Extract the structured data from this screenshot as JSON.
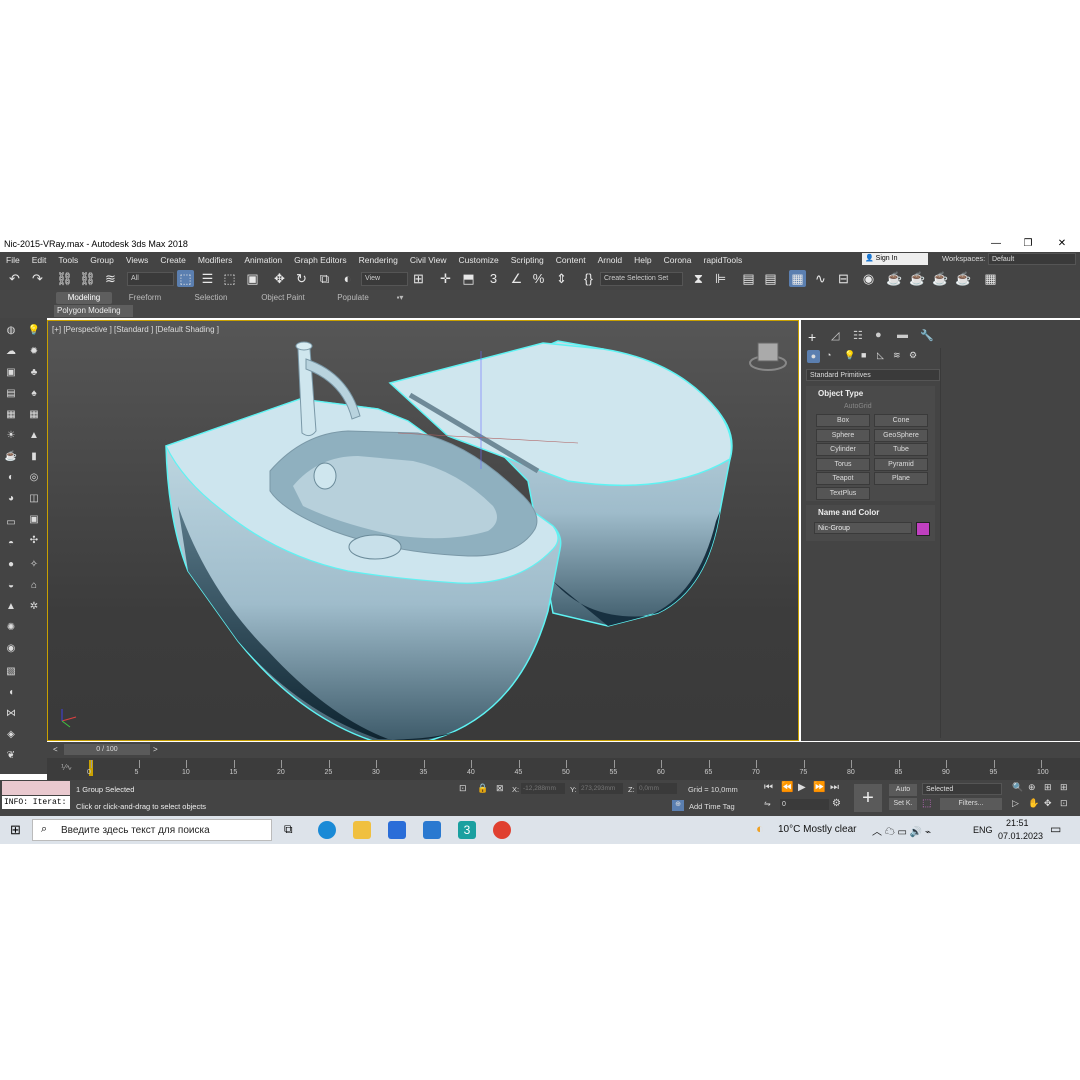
{
  "window": {
    "title": "Nic-2015-VRay.max - Autodesk 3ds Max 2018"
  },
  "menu": [
    "File",
    "Edit",
    "Tools",
    "Group",
    "Views",
    "Create",
    "Modifiers",
    "Animation",
    "Graph Editors",
    "Rendering",
    "Civil View",
    "Customize",
    "Scripting",
    "Content",
    "Arnold",
    "Help",
    "Corona",
    "rapidTools"
  ],
  "signin": {
    "label": "Sign In",
    "workspaces_label": "Workspaces:",
    "workspace_value": "Default"
  },
  "toolbar": {
    "filter_value": "All",
    "refcoord_value": "View",
    "selection_set_placeholder": "Create Selection Set"
  },
  "ribbon": {
    "tabs": [
      "Modeling",
      "Freeform",
      "Selection",
      "Object Paint",
      "Populate"
    ],
    "active_tab": "Modeling",
    "subtitle": "Polygon Modeling"
  },
  "viewport": {
    "label": "[+] [Perspective ] [Standard ] [Default Shading ]"
  },
  "command_panel": {
    "dropdown": "Standard Primitives",
    "object_type_title": "Object Type",
    "autogrid": "AutoGrid",
    "buttons": [
      "Box",
      "Cone",
      "Sphere",
      "GeoSphere",
      "Cylinder",
      "Tube",
      "Torus",
      "Pyramid",
      "Teapot",
      "Plane",
      "TextPlus"
    ],
    "name_color_title": "Name and Color",
    "object_name": "Nic-Group",
    "object_color": "#c040c0"
  },
  "timeline": {
    "frame_display": "0 / 100",
    "ticks": [
      "0",
      "5",
      "10",
      "15",
      "20",
      "25",
      "30",
      "35",
      "40",
      "45",
      "50",
      "55",
      "60",
      "65",
      "70",
      "75",
      "80",
      "85",
      "90",
      "95",
      "100"
    ]
  },
  "status": {
    "script_listener": "INFO: Iterat:",
    "selected_text": "1 Group Selected",
    "prompt_text": "Click or click-and-drag to select objects",
    "x_label": "X:",
    "x_value": "-12,288mm",
    "y_label": "Y:",
    "y_value": "273,293mm",
    "z_label": "Z:",
    "z_value": "0,0mm",
    "grid": "Grid = 10,0mm",
    "add_time_tag": "Add Time Tag",
    "auto_label": "Auto",
    "selected_dropdown": "Selected",
    "setk_label": "Set K.",
    "filters_label": "Filters...",
    "frame_value": "0"
  },
  "taskbar": {
    "search_placeholder": "Введите здесь текст для поиска",
    "weather": "10°C  Mostly clear",
    "lang": "ENG",
    "time": "21:51",
    "date": "07.01.2023"
  }
}
